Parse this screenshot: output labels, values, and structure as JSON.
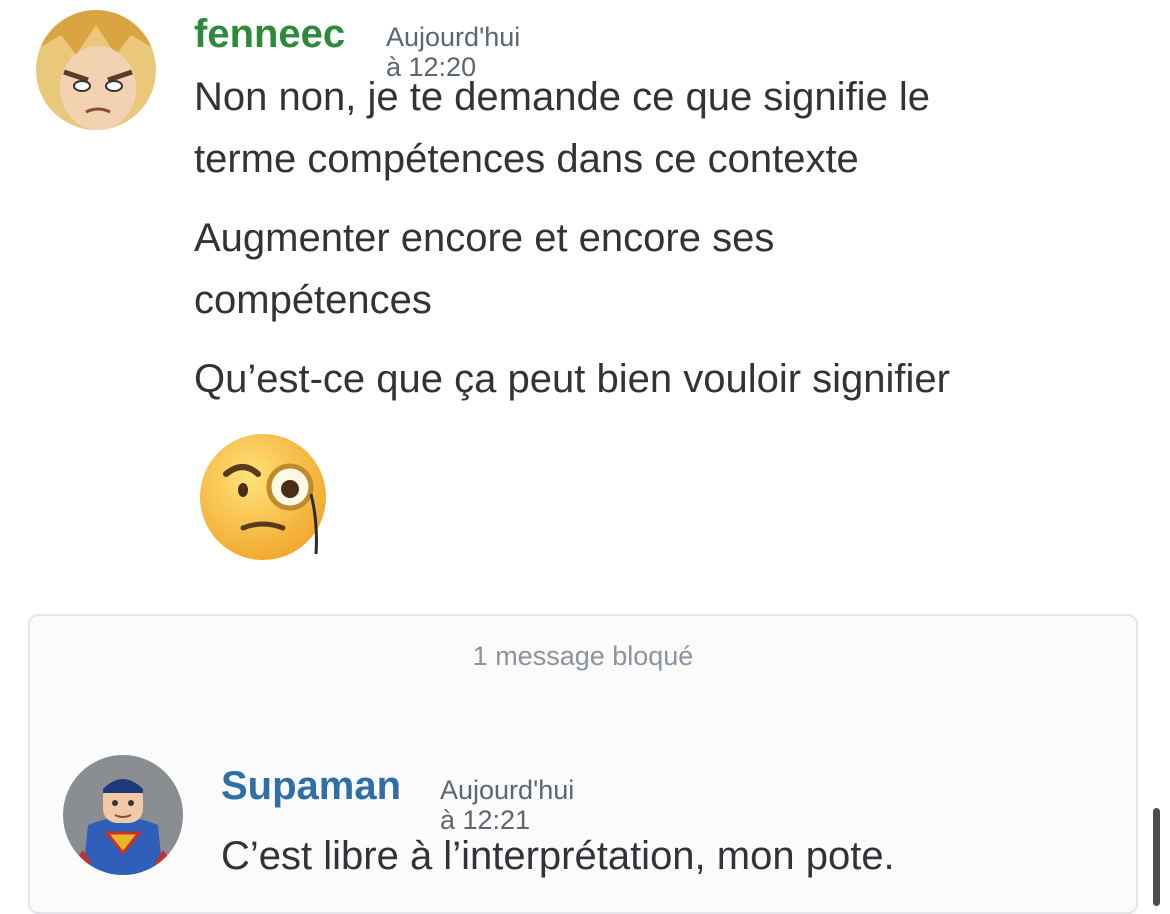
{
  "messages": [
    {
      "author": "fenneec",
      "author_color": "#2d8a3b",
      "timestamp": "Aujourd'hui à 12:20",
      "avatar_icon": "anime-character-avatar",
      "lines": [
        "Non non, je te demande ce que signifie le",
        "terme compétences dans ce contexte",
        "Augmenter encore et encore ses",
        "compétences",
        "Qu’est-ce que ça peut bien vouloir signifier"
      ],
      "emoji": "face-with-monocle-emoji"
    }
  ],
  "blocked": {
    "label": "1 message bloqué",
    "message": {
      "author": "Supaman",
      "author_color": "#2f6fa8",
      "timestamp": "Aujourd'hui à 12:21",
      "avatar_icon": "superhero-avatar",
      "text": "C’est libre à l’interprétation, mon pote."
    }
  }
}
